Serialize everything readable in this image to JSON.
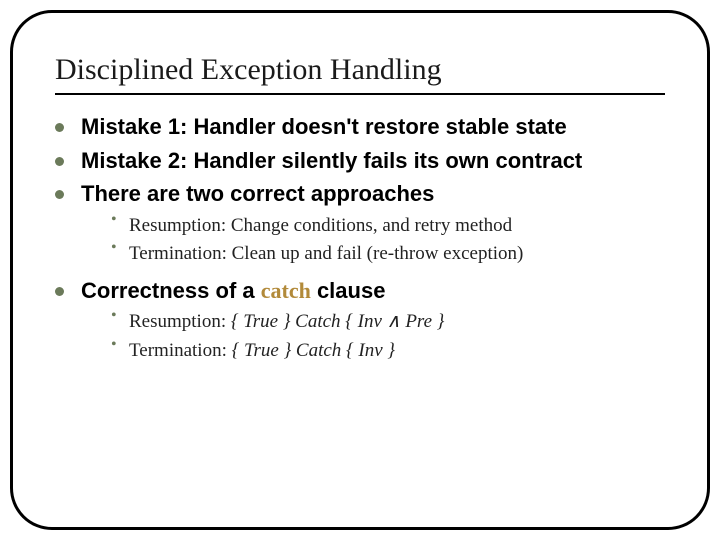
{
  "title": "Disciplined Exception Handling",
  "bullets": {
    "b0": "Mistake 1: Handler doesn't restore stable state",
    "b1": "Mistake 2: Handler silently fails its own contract",
    "b2": "There are two correct approaches",
    "b3_pre": "Correctness of a ",
    "b3_accent": "catch",
    "b3_post": " clause"
  },
  "sub1": {
    "s0": "Resumption: Change conditions, and retry method",
    "s1": "Termination: Clean up and fail (re-throw exception)"
  },
  "sub2": {
    "s0_a": "Resumption: ",
    "s0_b": "{ True } Catch { Inv ∧ Pre }",
    "s1_a": "Termination: ",
    "s1_b": "{ True } Catch { Inv }"
  }
}
